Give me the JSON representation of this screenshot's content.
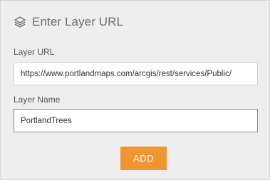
{
  "header": {
    "title": "Enter Layer URL",
    "icon": "layers-icon"
  },
  "layer_url": {
    "label": "Layer URL",
    "value": "https://www.portlandmaps.com/arcgis/rest/services/Public/"
  },
  "layer_name": {
    "label": "Layer Name",
    "value": "PortlandTrees"
  },
  "add_button": {
    "label": "ADD"
  },
  "colors": {
    "panel_background": "#eeeeee",
    "accent": "#f0962e",
    "focus_border": "#6b8fb5",
    "title_text": "#6e6e6e"
  }
}
